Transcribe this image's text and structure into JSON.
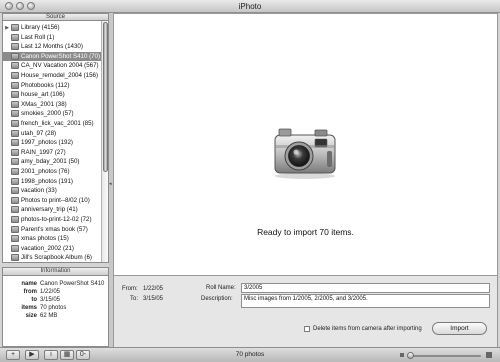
{
  "window": {
    "title": "iPhoto"
  },
  "sidebar": {
    "source_header": "Source",
    "items": [
      {
        "label": "Library (4156)",
        "icon": "library-icon",
        "expandable": true
      },
      {
        "label": "Last Roll (1)",
        "icon": "roll-icon"
      },
      {
        "label": "Last 12 Months (1430)",
        "icon": "calendar-icon"
      },
      {
        "label": "Canon PowerShot S410 (70)",
        "icon": "camera-icon",
        "selected": true
      },
      {
        "label": "CA_NV Vacation 2004 (567)",
        "icon": "album-icon"
      },
      {
        "label": "House_remodel_2004 (156)",
        "icon": "album-icon"
      },
      {
        "label": "Photobooks (112)",
        "icon": "album-icon"
      },
      {
        "label": "house_art (106)",
        "icon": "album-icon"
      },
      {
        "label": "XMas_2001 (38)",
        "icon": "album-icon"
      },
      {
        "label": "smokies_2000 (57)",
        "icon": "album-icon"
      },
      {
        "label": "french_lick_vac_2001 (85)",
        "icon": "album-icon"
      },
      {
        "label": "utah_97 (28)",
        "icon": "album-icon"
      },
      {
        "label": "1997_photos (192)",
        "icon": "album-icon"
      },
      {
        "label": "RAIN_1997 (27)",
        "icon": "album-icon"
      },
      {
        "label": "amy_bday_2001 (50)",
        "icon": "album-icon"
      },
      {
        "label": "2001_photos (76)",
        "icon": "album-icon"
      },
      {
        "label": "1998_photos (191)",
        "icon": "album-icon"
      },
      {
        "label": "vacation (33)",
        "icon": "album-icon"
      },
      {
        "label": "Photos to print--8/02 (10)",
        "icon": "album-icon"
      },
      {
        "label": "anniversary_trip (41)",
        "icon": "album-icon"
      },
      {
        "label": "photos-to-print-12-02 (72)",
        "icon": "album-icon"
      },
      {
        "label": "Parent's xmas book (57)",
        "icon": "album-icon"
      },
      {
        "label": "xmas photos (15)",
        "icon": "album-icon"
      },
      {
        "label": "vacation_2002 (21)",
        "icon": "album-icon"
      },
      {
        "label": "Jill's Scrapbook Album (6)",
        "icon": "album-icon"
      },
      {
        "label": "",
        "icon": "album-icon"
      }
    ]
  },
  "information": {
    "header": "Information",
    "rows": [
      {
        "key": "name",
        "value": "Canon PowerShot S410"
      },
      {
        "key": "from",
        "value": "1/22/05"
      },
      {
        "key": "to",
        "value": "3/15/05"
      },
      {
        "key": "items",
        "value": "70 photos"
      },
      {
        "key": "size",
        "value": "62 MB"
      }
    ]
  },
  "main": {
    "status": "Ready to import 70 items.",
    "icon": "camera-icon"
  },
  "import_form": {
    "from_label": "From:",
    "from_value": "1/22/05",
    "to_label": "To:",
    "to_value": "3/15/05",
    "roll_name_label": "Roll Name:",
    "roll_name_value": "3/2005",
    "description_label": "Description:",
    "description_value": "Misc images from 1/2005, 2/2005, and 3/2005.",
    "delete_checkbox_label": "Delete items from camera after importing",
    "delete_checked": false,
    "import_button": "Import"
  },
  "toolbar": {
    "add_label": "+",
    "play_label": "▶",
    "info_label": "i",
    "calendar_label": "▦",
    "keywords_label": "0-",
    "photo_count": "70 photos",
    "zoom_level": 0.02
  }
}
